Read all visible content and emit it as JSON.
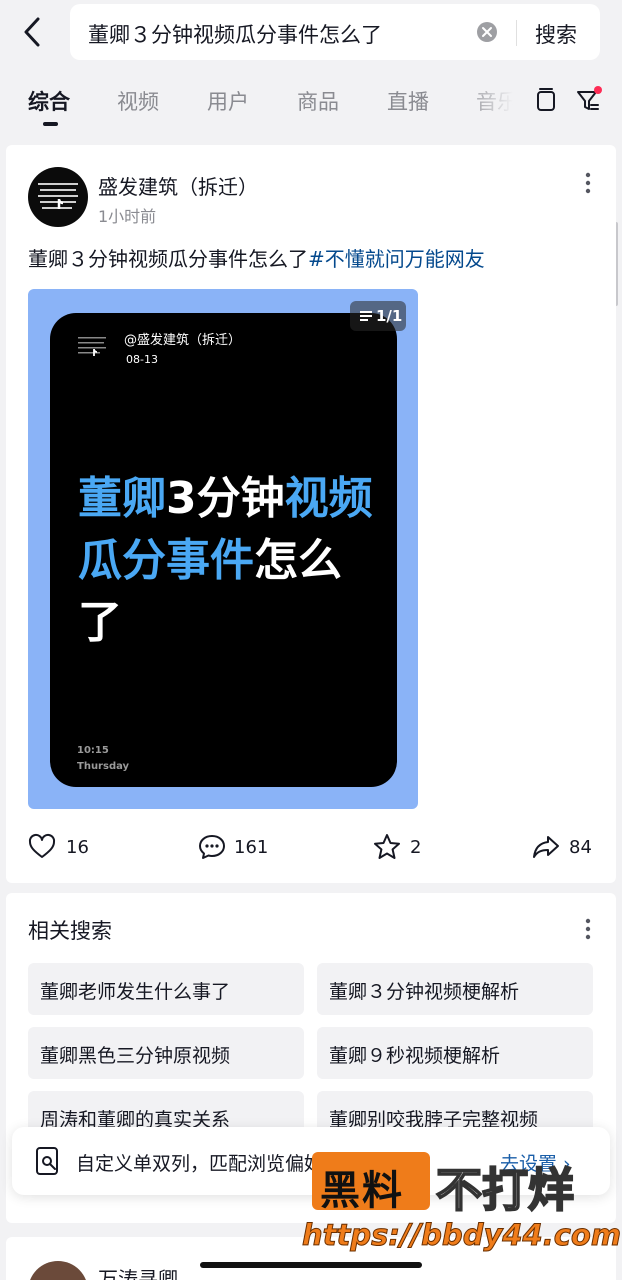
{
  "search": {
    "query": "董卿３分钟视频瓜分事件怎么了",
    "button_label": "搜索"
  },
  "tabs": [
    {
      "label": "综合",
      "active": true
    },
    {
      "label": "视频"
    },
    {
      "label": "用户"
    },
    {
      "label": "商品"
    },
    {
      "label": "直播"
    },
    {
      "label": "音乐"
    }
  ],
  "post": {
    "author": "盛发建筑（拆迁）",
    "time": "1小时前",
    "text": "董卿３分钟视频瓜分事件怎么了",
    "hashtag": "#不懂就问万能网友",
    "media": {
      "page_indicator": "1/1",
      "overlay_name": "@盛发建筑（拆迁）",
      "overlay_date": "08-13",
      "headline_parts": [
        {
          "text": "董卿",
          "color": "blue"
        },
        {
          "text": "3分钟",
          "color": "white"
        },
        {
          "text": "视频",
          "color": "blue"
        },
        {
          "text": "瓜分事件",
          "color": "blue"
        },
        {
          "text": "怎么",
          "color": "white"
        },
        {
          "text": "了",
          "color": "white"
        }
      ],
      "phone_time": "10:15",
      "phone_day": "Thursday"
    },
    "actions": {
      "likes": "16",
      "comments": "161",
      "favorites": "2",
      "shares": "84"
    }
  },
  "related": {
    "title": "相关搜索",
    "items": [
      "董卿老师发生什么事了",
      "董卿３分钟视频梗解析",
      "董卿黑色三分钟原视频",
      "董卿９秒视频梗解析",
      "周涛和董卿的真实关系",
      "董卿别咬我脖子完整视频"
    ]
  },
  "banner": {
    "text": "自定义单双列，匹配浏览偏好",
    "link": "去设置 ›"
  },
  "watermark": {
    "box": "黑料",
    "text": "不打烊",
    "url": "https://bbdy44.com"
  },
  "next_post": {
    "author": "万涛寻卿"
  },
  "colors": {
    "background": "#f2f2f4",
    "hashtag": "#04498d",
    "headline_blue": "#4aa8f4",
    "media_bg": "#8ab3f7",
    "notification_dot": "#fe2c55",
    "watermark_orange": "#ef7c1a"
  }
}
